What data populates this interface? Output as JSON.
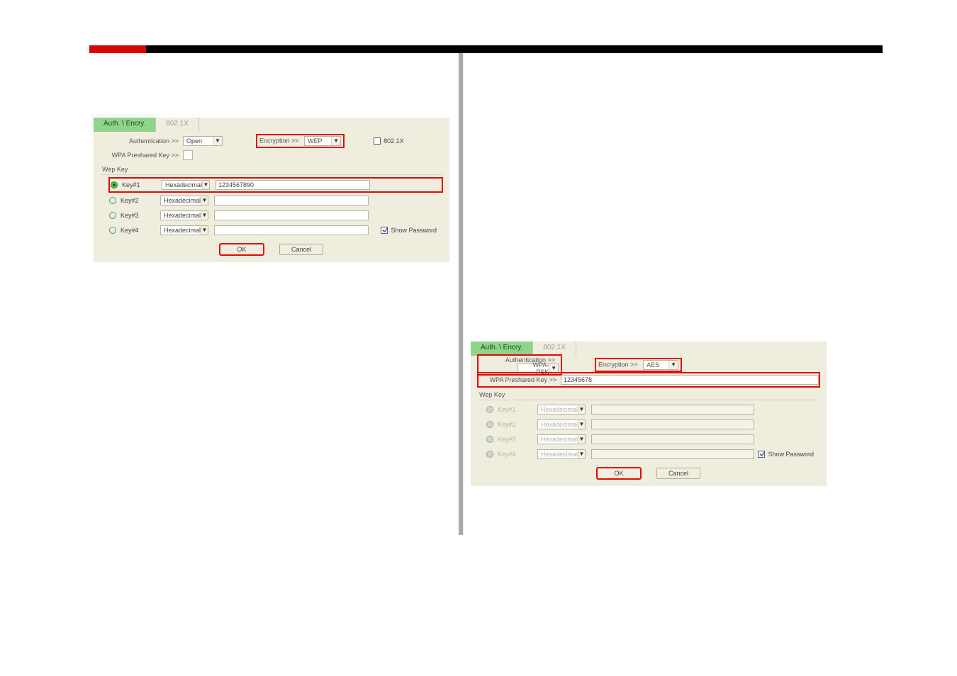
{
  "tabs": {
    "auth": "Auth. \\ Encry.",
    "8021x": "802.1X"
  },
  "labels": {
    "authentication": "Authentication >>",
    "encryption": "Encryption >>",
    "wpa_preshared": "WPA Preshared Key >>",
    "8021x_chk": "802.1X",
    "wep_group": "Wep Key",
    "show_password": "Show Password",
    "ok": "OK",
    "cancel": "Cancel"
  },
  "d1": {
    "auth_value": "Open",
    "enc_value": "WEP",
    "wpa_value": "",
    "keys": [
      {
        "name": "Key#1",
        "fmt": "Hexadecimal",
        "value": "1234567890",
        "selected": true,
        "enabled": true
      },
      {
        "name": "Key#2",
        "fmt": "Hexadecimal",
        "value": "",
        "selected": false,
        "enabled": true
      },
      {
        "name": "Key#3",
        "fmt": "Hexadecimal",
        "value": "",
        "selected": false,
        "enabled": true
      },
      {
        "name": "Key#4",
        "fmt": "Hexadecimal",
        "value": "",
        "selected": false,
        "enabled": true
      }
    ],
    "show_pw_checked": true
  },
  "d2": {
    "auth_value": "WPA-PSK",
    "enc_value": "AES",
    "wpa_value": "12345678",
    "keys": [
      {
        "name": "Key#1",
        "fmt": "Hexadecimal",
        "value": "",
        "selected": false,
        "enabled": false
      },
      {
        "name": "Key#2",
        "fmt": "Hexadecimal",
        "value": "",
        "selected": false,
        "enabled": false
      },
      {
        "name": "Key#3",
        "fmt": "Hexadecimal",
        "value": "",
        "selected": false,
        "enabled": false
      },
      {
        "name": "Key#4",
        "fmt": "Hexadecimal",
        "value": "",
        "selected": false,
        "enabled": false
      }
    ],
    "show_pw_checked": true
  }
}
